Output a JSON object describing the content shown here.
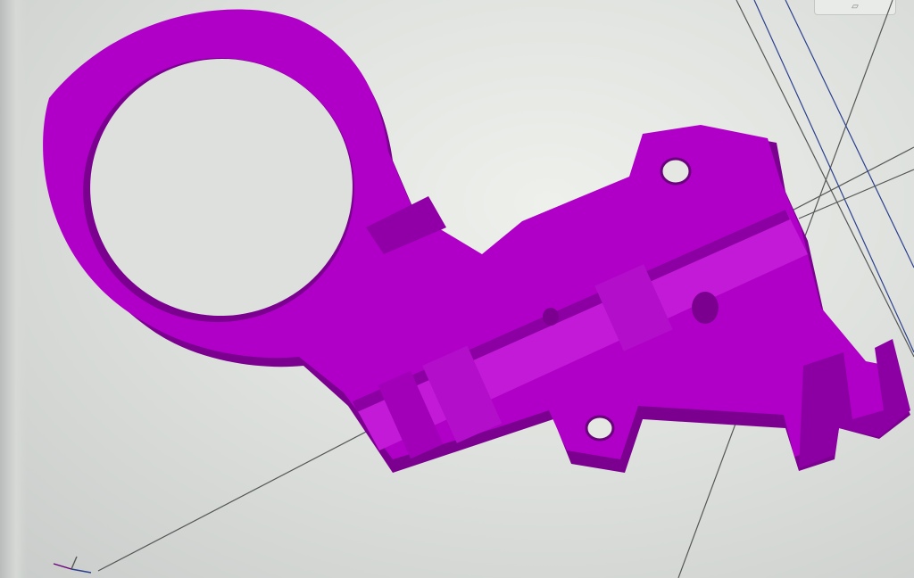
{
  "app": {
    "window_title": ""
  },
  "viewport": {
    "background": "#dfe2de",
    "grid_line_color": "#4a4d4c",
    "guide_line_color": "#2b3f8f"
  },
  "model": {
    "name": "",
    "color": "#b000c8",
    "shadow_color": "#7b0090",
    "highlight_color": "#c21ad6"
  },
  "toolbar": {
    "icon": "cube-view-icon"
  },
  "axis": {
    "icon": "axis-triad-icon"
  }
}
